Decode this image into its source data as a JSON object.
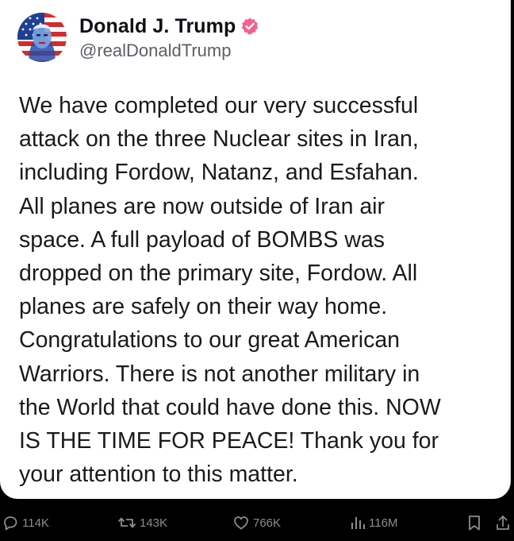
{
  "post": {
    "author": {
      "display_name": "Donald J. Trump",
      "handle": "@realDonaldTrump",
      "verified_badge_color": "#f5618c",
      "avatar_icon": "american-flag-portrait-avatar"
    },
    "text_lines": [
      "We have completed our very successful",
      "attack on the three Nuclear sites in Iran,",
      "including Fordow, Natanz, and Esfahan.",
      "All planes are now outside of Iran air",
      "space. A full payload of BOMBS was",
      "dropped on the primary site, Fordow. All",
      "planes are safely on their way home.",
      "Congratulations to our great American",
      "Warriors. There is not another military in",
      "the World that could have done this. NOW",
      "IS THE TIME FOR PEACE! Thank you for",
      "your attention to this matter."
    ]
  },
  "actions": {
    "replies": {
      "icon": "reply-icon",
      "count": "114K"
    },
    "reposts": {
      "icon": "repost-icon",
      "count": "143K"
    },
    "likes": {
      "icon": "heart-icon",
      "count": "766K"
    },
    "views": {
      "icon": "views-icon",
      "count": "116M"
    },
    "bookmark": {
      "icon": "bookmark-icon"
    },
    "share": {
      "icon": "share-icon"
    }
  },
  "colors": {
    "page_background": "#000000",
    "card_background": "#ffffff",
    "text_primary": "#1a1a1e",
    "text_secondary": "#5b5f66",
    "action_gray": "#8a8d91"
  }
}
